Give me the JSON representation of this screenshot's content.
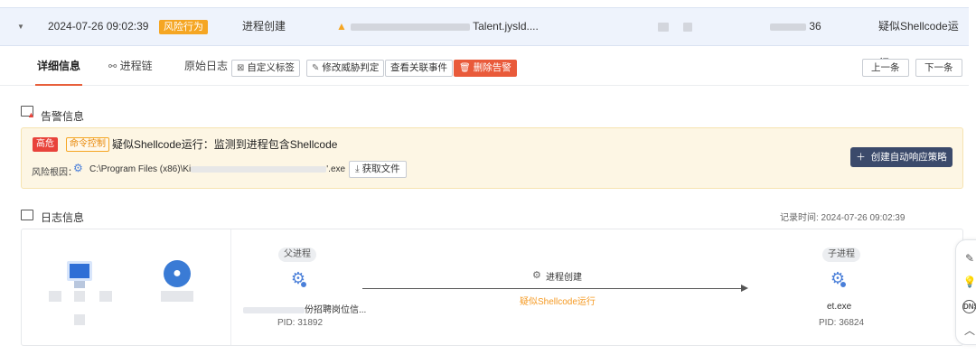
{
  "alert_row": {
    "time": "2024-07-26 09:02:39",
    "risk_tag": "风险行为",
    "event_type": "进程创建",
    "target_suffix": "Talent.jysld....",
    "host_suffix": "36",
    "rule": "疑似Shellcode运行"
  },
  "tabs": {
    "detail": "详细信息",
    "process_chain": "进程链",
    "raw_log": "原始日志"
  },
  "actions": {
    "custom_tag": "自定义标签",
    "modify_judgment": "修改威胁判定",
    "view_related": "查看关联事件",
    "delete_alert": "删除告警",
    "prev": "上一条",
    "next": "下一条"
  },
  "alert_info": {
    "section_title": "告警信息",
    "level": "高危",
    "category": "命令控制",
    "title": "疑似Shellcode运行：监测到进程包含Shellcode",
    "root_label": "风险根因：",
    "root_path_prefix": "C:\\Program Files (x86)\\Ki",
    "root_path_suffix": "'.exe",
    "get_file": "获取文件",
    "create_policy": "创建自动响应策略"
  },
  "log_info": {
    "section_title": "日志信息",
    "record_time": "记录时间: 2024-07-26 09:02:39",
    "parent": {
      "label": "父进程",
      "name_suffix": "份招聘岗位信...",
      "pid": "PID: 31892"
    },
    "action": "进程创建",
    "suspicion": "疑似Shellcode运行",
    "child": {
      "label": "子进程",
      "name": "et.exe",
      "pid": "PID: 36824"
    }
  },
  "icons": {
    "edit": "edit-icon",
    "bulb": "bulb-icon",
    "dns": "DNS",
    "up": "chevron-up-icon"
  },
  "colors": {
    "accent_tab": "#e8603c",
    "risk_tag": "#f5a623",
    "level_high": "#e8433b",
    "delete_button": "#e95a3a",
    "create_button": "#3b4a6b",
    "process_icon": "#4a7fd9"
  }
}
